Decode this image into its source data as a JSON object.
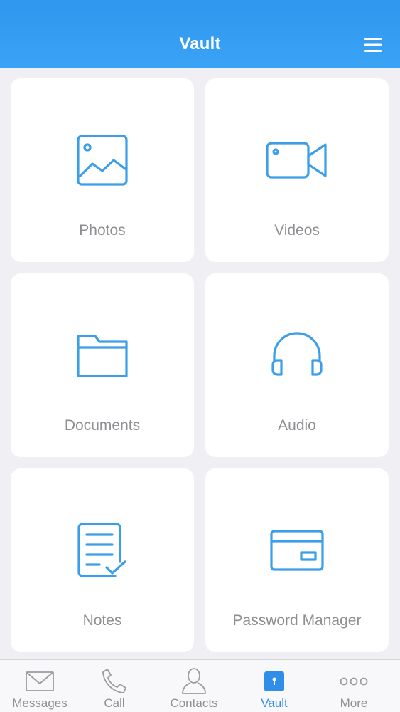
{
  "header": {
    "title": "Vault",
    "menu_icon": "hamburger-menu-icon"
  },
  "tiles": [
    {
      "label": "Photos",
      "icon": "photo-icon"
    },
    {
      "label": "Videos",
      "icon": "video-camera-icon"
    },
    {
      "label": "Documents",
      "icon": "folder-icon"
    },
    {
      "label": "Audio",
      "icon": "headphones-icon"
    },
    {
      "label": "Notes",
      "icon": "note-check-icon"
    },
    {
      "label": "Password Manager",
      "icon": "card-icon"
    }
  ],
  "tabbar": {
    "active": "Vault",
    "items": [
      {
        "label": "Messages",
        "icon": "envelope-icon"
      },
      {
        "label": "Call",
        "icon": "phone-icon"
      },
      {
        "label": "Contacts",
        "icon": "person-icon"
      },
      {
        "label": "Vault",
        "icon": "vault-lock-icon"
      },
      {
        "label": "More",
        "icon": "more-dots-icon"
      }
    ]
  },
  "colors": {
    "header": "#2f97ee",
    "accent": "#3a9ee8",
    "label_gray": "#8e8e93",
    "background": "#efeff4",
    "tile": "#ffffff"
  }
}
